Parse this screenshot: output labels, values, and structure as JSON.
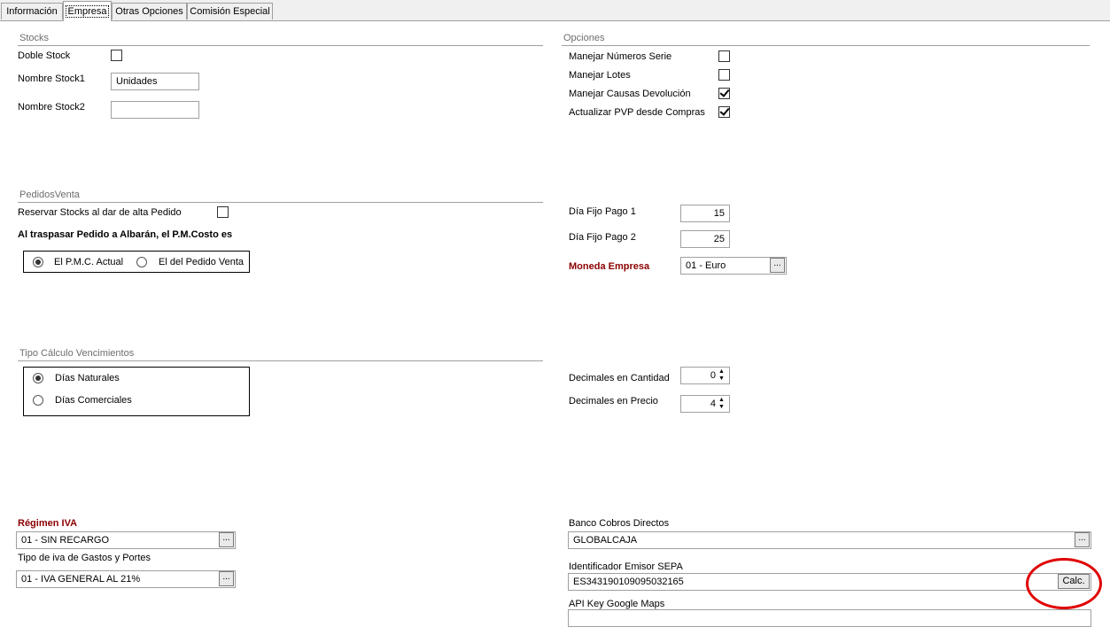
{
  "tabs": [
    "Información",
    "Empresa",
    "Otras Opciones",
    "Comisión Especial"
  ],
  "stocks": {
    "title": "Stocks",
    "doble_stock": "Doble Stock",
    "nombre_stock1": "Nombre Stock1",
    "nombre_stock1_value": "Unidades",
    "nombre_stock2": "Nombre Stock2",
    "nombre_stock2_value": ""
  },
  "opciones": {
    "title": "Opciones",
    "items": [
      {
        "label": "Manejar Números Serie",
        "checked": false
      },
      {
        "label": "Manejar Lotes",
        "checked": false
      },
      {
        "label": "Manejar Causas Devolución",
        "checked": true
      },
      {
        "label": "Actualizar PVP desde Compras",
        "checked": true
      }
    ]
  },
  "pedidos": {
    "title": "PedidosVenta",
    "reservar": "Reservar Stocks al dar de alta Pedido",
    "traspasar": "Al traspasar Pedido a Albarán, el P.M.Costo es",
    "opt1": "El P.M.C. Actual",
    "opt2": "El del Pedido Venta"
  },
  "pago": {
    "dia1_label": "Día Fijo Pago 1",
    "dia1_value": "15",
    "dia2_label": "Día Fijo Pago 2",
    "dia2_value": "25",
    "moneda_label": "Moneda Empresa",
    "moneda_value": "01 - Euro"
  },
  "vencimientos": {
    "title": "Tipo Cálculo Vencimientos",
    "opt1": "Días Naturales",
    "opt2": "Días Comerciales"
  },
  "decimales": {
    "cantidad_label": "Decimales en Cantidad",
    "cantidad_value": "0",
    "precio_label": "Decimales en Precio",
    "precio_value": "4"
  },
  "iva": {
    "regimen_label": "Régimen IVA",
    "regimen_value": "01 - SIN RECARGO",
    "tipo_label": "Tipo de iva de Gastos y Portes",
    "tipo_value": "01 - IVA GENERAL AL 21%"
  },
  "banco": {
    "label": "Banco Cobros Directos",
    "value": "GLOBALCAJA",
    "sepa_label": "Identificador Emisor SEPA",
    "sepa_value": "ES343190109095032165",
    "calc": "Calc.",
    "api_label": "API Key Google Maps",
    "api_value": ""
  },
  "buttons": {
    "dots": "..."
  },
  "colors": {
    "accent_red": "#8b0000",
    "highlight_circle": "#e00000"
  }
}
